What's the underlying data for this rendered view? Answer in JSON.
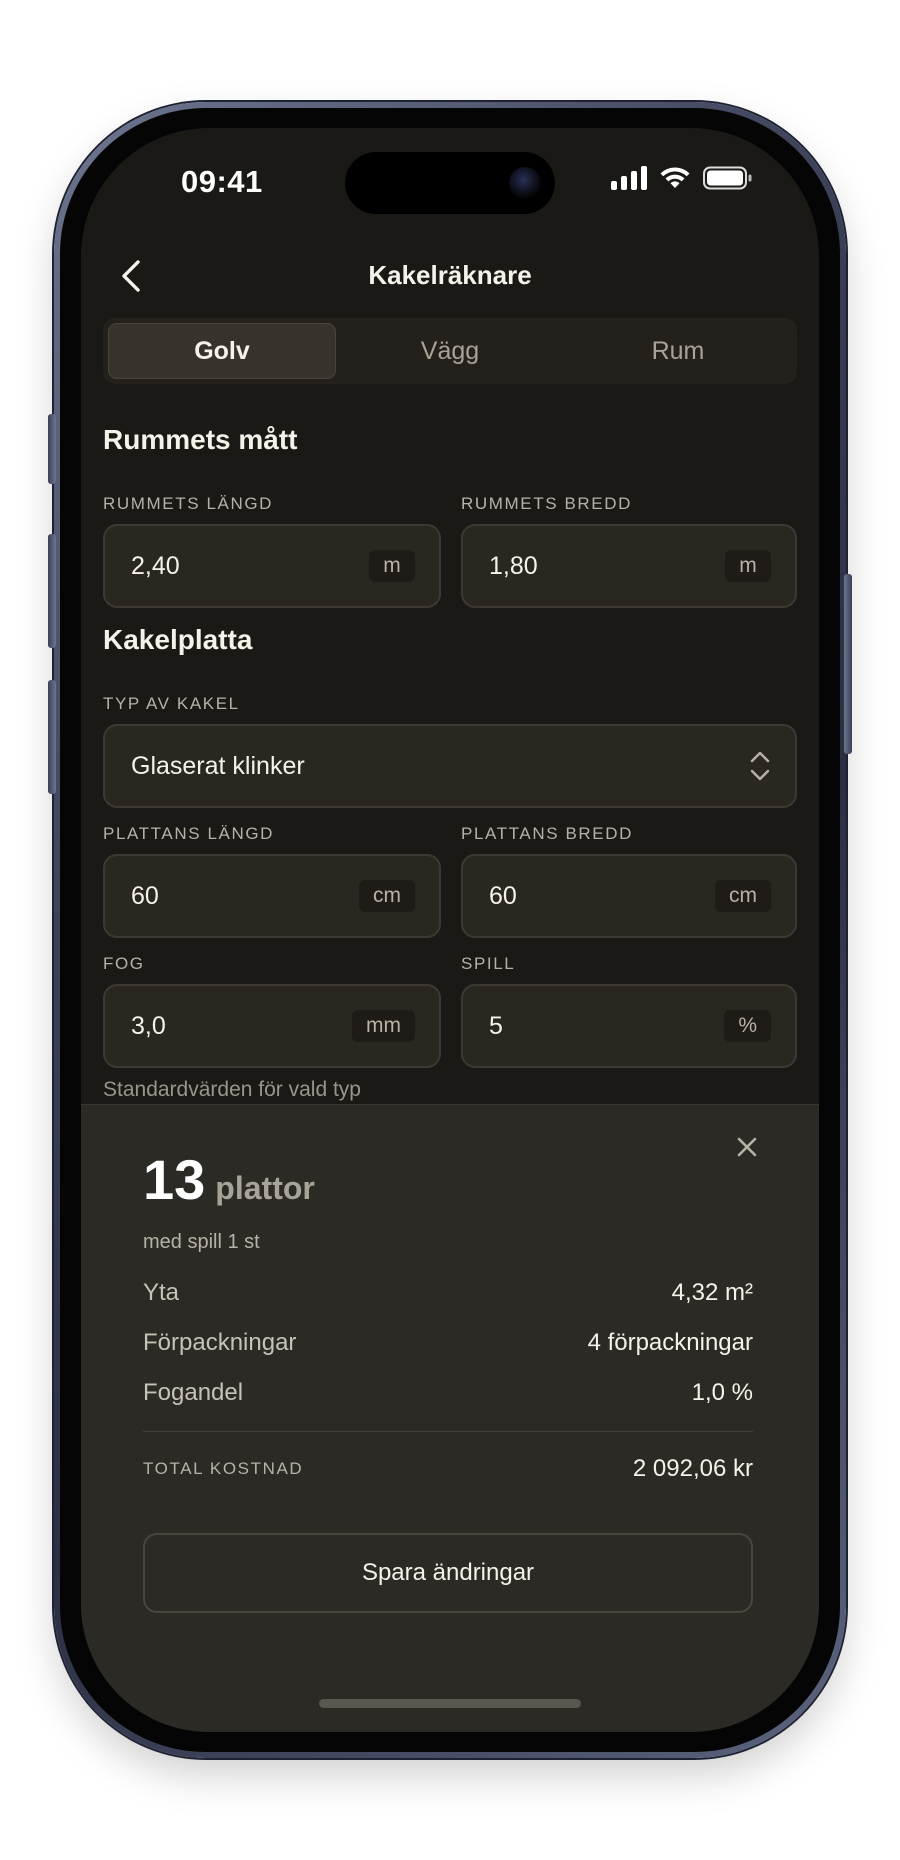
{
  "status_bar": {
    "time": "09:41"
  },
  "nav": {
    "title": "Kakelräknare"
  },
  "tabs": [
    {
      "label": "Golv",
      "active": true
    },
    {
      "label": "Vägg",
      "active": false
    },
    {
      "label": "Rum",
      "active": false
    }
  ],
  "room": {
    "section_title": "Rummets mått",
    "length": {
      "label": "RUMMETS LÄNGD",
      "value": "2,40",
      "unit": "m"
    },
    "width": {
      "label": "RUMMETS BREDD",
      "value": "1,80",
      "unit": "m"
    }
  },
  "tile": {
    "section_title": "Kakelplatta",
    "type": {
      "label": "TYP AV KAKEL",
      "value": "Glaserat klinker"
    },
    "length": {
      "label": "PLATTANS LÄNGD",
      "value": "60",
      "unit": "cm"
    },
    "width": {
      "label": "PLATTANS BREDD",
      "value": "60",
      "unit": "cm"
    },
    "joint": {
      "label": "FOG",
      "value": "3,0",
      "unit": "mm"
    },
    "waste": {
      "label": "SPILL",
      "value": "5",
      "unit": "%"
    },
    "helper": "Standardvärden för vald typ"
  },
  "result": {
    "count": "13",
    "count_unit": "plattor",
    "subtitle": "med spill 1 st",
    "rows": [
      {
        "label": "Yta",
        "value": "4,32 m²"
      },
      {
        "label": "Förpackningar",
        "value": "4 förpackningar"
      },
      {
        "label": "Fogandel",
        "value": "1,0 %"
      }
    ],
    "total": {
      "label": "TOTAL KOSTNAD",
      "value": "2 092,06 kr"
    },
    "save_label": "Spara ändringar"
  },
  "colors": {
    "background": "#1a1916",
    "panel": "#2c2a24",
    "input": "#2a2721",
    "text": "#f5f2ea",
    "muted": "#b7b2a7"
  },
  "icons": {
    "back": "chevron-left-icon",
    "select": "chevron-up-down-icon",
    "close": "close-icon",
    "signal": "cellular-signal-icon",
    "wifi": "wifi-icon",
    "battery": "battery-icon"
  }
}
